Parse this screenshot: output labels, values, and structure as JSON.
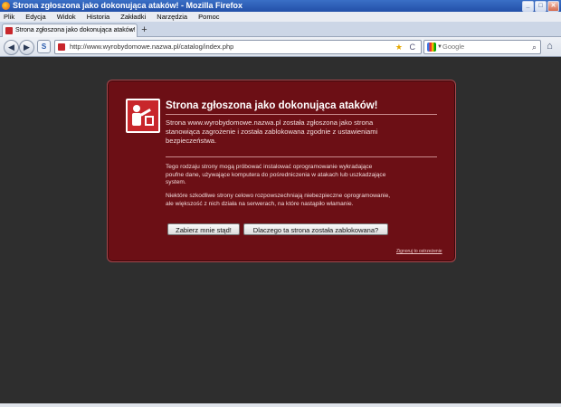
{
  "window": {
    "title": "Strona zgłoszona jako dokonująca ataków! - Mozilla Firefox",
    "buttons": {
      "minimize": "_",
      "maximize": "□",
      "close": "✕"
    }
  },
  "menu": [
    "Plik",
    "Edycja",
    "Widok",
    "Historia",
    "Zakładki",
    "Narzędzia",
    "Pomoc"
  ],
  "tab": {
    "label": "Strona zgłoszona jako dokonująca ataków!",
    "close": "×",
    "new_tab": "+"
  },
  "nav": {
    "back": "◀",
    "forward": "▶",
    "s_button": "S",
    "url": "http://www.wyrobydomowe.nazwa.pl/catalog/index.php",
    "star": "★",
    "reload": "C",
    "search_placeholder": "Google",
    "search_icon": "⌕",
    "home": "⌂"
  },
  "warning": {
    "heading": "Strona zgłoszona jako dokonująca ataków!",
    "intro": "Strona www.wyrobydomowe.nazwa.pl została zgłoszona jako strona stanowiąca zagrożenie i została zablokowana zgodnie z ustawieniami bezpieczeństwa.",
    "para1": "Tego rodzaju strony mogą próbować instalować oprogramowanie wykradające poufne dane, używające komputera do pośredniczenia w atakach lub uszkadzające system.",
    "para2": "Niektóre szkodliwe strony celowo rozpowszechniają niebezpieczne oprogramowanie, ale większość z nich działa na serwerach, na które nastąpiło włamanie.",
    "button_get_me_out": "Zabierz mnie stąd!",
    "button_why_blocked": "Dlaczego ta strona została zablokowana?",
    "report_link": "Zignoruj to ostrzeżenie"
  },
  "colors": {
    "panel_bg": "#6c0f15",
    "page_bg": "#2e2e2e",
    "titlebar": "#2350a8"
  }
}
